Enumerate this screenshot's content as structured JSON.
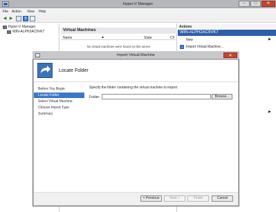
{
  "window": {
    "title": "Hyper-V Manager",
    "minimize": "–",
    "maximize": "□",
    "close": "✕"
  },
  "menu": {
    "items": [
      "File",
      "Action",
      "View",
      "Help"
    ]
  },
  "toolbar": {
    "icons": [
      "back-arrow-icon",
      "forward-arrow-icon",
      "console-tree-icon",
      "help-icon",
      "properties-icon"
    ]
  },
  "tree": {
    "root": "Hyper-V Manager",
    "host": "WIN-ALPH2AC9VK7"
  },
  "center": {
    "section_title": "Virtual Machines",
    "col_name": "Name",
    "col_state": "State",
    "col_cpu": "CF",
    "empty_message": "No virtual machines were found on this server."
  },
  "actions": {
    "title": "Actions",
    "host": "WIN-ALPH2AC9VK7",
    "items": [
      "New",
      "Import Virtual Machine..."
    ]
  },
  "dialog": {
    "title": "Import Virtual Machine",
    "close": "✕",
    "header_title": "Locate Folder",
    "steps": [
      "Before You Begin",
      "Locate Folder",
      "Select Virtual Machine",
      "Choose Import Type",
      "Summary"
    ],
    "active_step": 1,
    "instruction": "Specify the folder containing the virtual machine to import.",
    "folder_label": "Folder:",
    "folder_value": "",
    "browse_label": "Browse...",
    "buttons": {
      "previous": "< Previous",
      "next": "Next >",
      "finish": "Finish",
      "cancel": "Cancel"
    }
  }
}
